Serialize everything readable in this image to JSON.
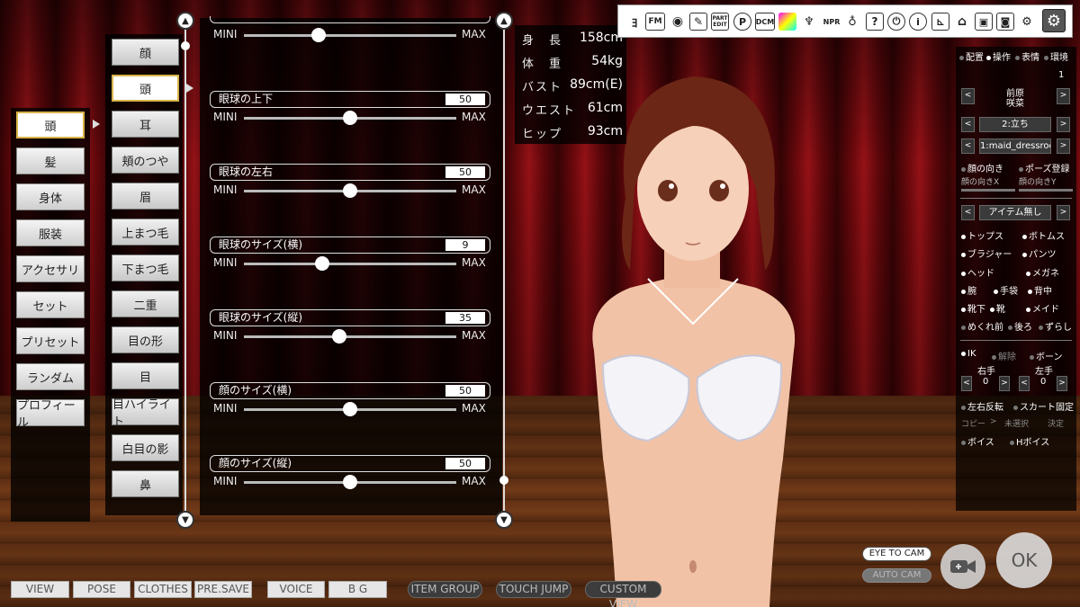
{
  "categories": [
    "頭",
    "髪",
    "身体",
    "服装",
    "アクセサリ",
    "セット",
    "プリセット",
    "ランダム",
    "プロフィール"
  ],
  "active_category": "頭",
  "subcategories": [
    "顔",
    "頭",
    "耳",
    "頬のつや",
    "眉",
    "上まつ毛",
    "下まつ毛",
    "二重",
    "目の形",
    "目",
    "目ハイライト",
    "白目の影",
    "鼻"
  ],
  "active_subcategory": "頭",
  "sliders": {
    "mini_label": "MINI",
    "max_label": "MAX",
    "items": [
      {
        "name": "",
        "value": "",
        "fraction": 0.35,
        "partial": true
      },
      {
        "name": "眼球の上下",
        "value": "50",
        "fraction": 0.5
      },
      {
        "name": "眼球の左右",
        "value": "50",
        "fraction": 0.5
      },
      {
        "name": "眼球のサイズ(横)",
        "value": "9",
        "fraction": 0.37
      },
      {
        "name": "眼球のサイズ(縦)",
        "value": "35",
        "fraction": 0.45
      },
      {
        "name": "顔のサイズ(横)",
        "value": "50",
        "fraction": 0.5
      },
      {
        "name": "顔のサイズ(縦)",
        "value": "50",
        "fraction": 0.5
      }
    ]
  },
  "stats": [
    {
      "label": "身　長",
      "value": "158cm"
    },
    {
      "label": "体　重",
      "value": "54kg"
    },
    {
      "label": "バスト",
      "value": "89cm(E)"
    },
    {
      "label": "ウエスト",
      "value": "61cm"
    },
    {
      "label": "ヒップ",
      "value": "93cm"
    }
  ],
  "toolbar": {
    "icons": [
      "yotogi-icon",
      "fm-icon",
      "eye-icon",
      "wrench-icon",
      "part-edit-icon",
      "p-icon",
      "dcm-icon",
      "color-icon",
      "trophy-icon",
      "npr-icon",
      "pin-icon",
      "help-icon",
      "power-icon",
      "info-icon",
      "chart-icon",
      "basket-icon",
      "save-icon",
      "camera-icon",
      "gears-icon",
      "settings-icon"
    ],
    "labels": {
      "fm": "FM",
      "part_edit": "PART EDIT",
      "p": "P",
      "dcm": "DCM",
      "npr": "NPR",
      "help": "?",
      "info": "i"
    }
  },
  "right_panel": {
    "tabs": [
      "配置",
      "操作",
      "表情",
      "環境"
    ],
    "index": "1",
    "name_line1": "前原",
    "name_line2": "咲菜",
    "pose": "2:立ち",
    "bg": "1:maid_dressroo",
    "face_dir": "顔の向き",
    "pose_register": "ポーズ登録",
    "face_x": "顔の向きX",
    "face_y": "顔の向きY",
    "item": "アイテム無し",
    "toggles_row1": [
      "トップス",
      "ボトムス"
    ],
    "toggles_row2": [
      "ブラジャー",
      "パンツ"
    ],
    "toggles_row3": [
      "ヘッド",
      "メガネ"
    ],
    "toggles_row4": [
      "腕",
      "手袋",
      "背中"
    ],
    "toggles_row5": [
      "靴下",
      "靴",
      "メイド"
    ],
    "toggles_row6": [
      "めくれ前",
      "後ろ",
      "ずらし"
    ],
    "ik": "IK",
    "release": "解除",
    "bone": "ボーン",
    "right_hand": "右手",
    "left_hand": "左手",
    "right_val": "0",
    "left_val": "0",
    "mirror": "左右反転",
    "skirt_fix": "スカート固定",
    "copy": "コピー",
    "unselected": "未選択",
    "decide": "決定",
    "voice": "ボイス",
    "h_voice": "Hボイス"
  },
  "bottom_tabs": [
    "VIEW",
    "POSE",
    "CLOTHES",
    "PRE.SAVE",
    "VOICE",
    "B G",
    "ITEM GROUP",
    "TOUCH JUMP",
    "CUSTOM VIEW"
  ],
  "camera": {
    "eye_to_cam": "EYE TO CAM",
    "auto_cam": "AUTO CAM"
  },
  "ok_label": "OK"
}
